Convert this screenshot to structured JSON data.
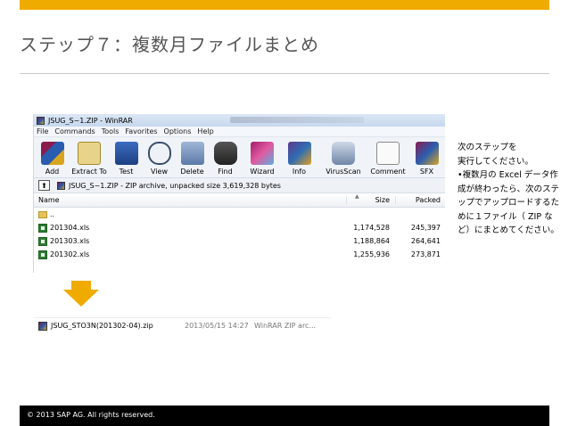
{
  "slide": {
    "title": "ステップ７：複数月ファイルまとめ",
    "footer": "© 2013 SAP AG. All rights reserved.",
    "accent_color": "#f0ab00"
  },
  "winrar": {
    "title": "JSUG_S~1.ZIP - WinRAR",
    "menu": [
      "File",
      "Commands",
      "Tools",
      "Favorites",
      "Options",
      "Help"
    ],
    "toolbar": [
      {
        "label": "Add",
        "icon": "add-archive-icon"
      },
      {
        "label": "Extract To",
        "icon": "extract-icon"
      },
      {
        "label": "Test",
        "icon": "test-icon"
      },
      {
        "label": "View",
        "icon": "view-icon"
      },
      {
        "label": "Delete",
        "icon": "delete-icon"
      },
      {
        "label": "Find",
        "icon": "find-binoculars-icon"
      },
      {
        "label": "Wizard",
        "icon": "wizard-icon"
      },
      {
        "label": "Info",
        "icon": "info-icon"
      },
      {
        "label": "VirusScan",
        "icon": "virusscan-icon"
      },
      {
        "label": "Comment",
        "icon": "comment-icon"
      },
      {
        "label": "SFX",
        "icon": "sfx-icon"
      }
    ],
    "address": "JSUG_S~1.ZIP - ZIP archive, unpacked size 3,619,328 bytes",
    "columns": {
      "name": "Name",
      "size": "Size",
      "packed": "Packed"
    },
    "parent_row": "..",
    "rows": [
      {
        "name": "201304.xls",
        "size": "1,174,528",
        "packed": "245,397"
      },
      {
        "name": "201303.xls",
        "size": "1,188,864",
        "packed": "264,641"
      },
      {
        "name": "201302.xls",
        "size": "1,255,936",
        "packed": "273,871"
      }
    ]
  },
  "result": {
    "name": "JSUG_STO3N(201302-04).zip",
    "date": "2013/05/15 14:27",
    "type": "WinRAR ZIP arc..."
  },
  "note": {
    "heading_line1": "次のステップを",
    "heading_line2": "実行してください。",
    "bullet": "•複数月の Excel データ作成が終わったら、次のステップでアップロードするために１ファイル（ ZIP など）にまとめてください。"
  }
}
